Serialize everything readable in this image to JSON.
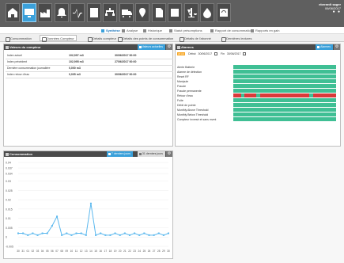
{
  "topbar": {
    "icons": [
      "home-icon",
      "monitor-icon",
      "factory-icon",
      "bell-icon",
      "pulse-icon",
      "building-icon",
      "network-icon",
      "truck-icon",
      "map-pin-icon",
      "document-icon",
      "list-icon",
      "scale-icon",
      "drop-icon",
      "gauge-icon"
    ],
    "active_index": 1,
    "user_line1": "eberardt sager",
    "user_line2": "06/06/2017",
    "user_dots": "● ●"
  },
  "nav1": {
    "items": [
      {
        "label": "Synthèse",
        "active": true
      },
      {
        "label": "Analyse",
        "active": false
      },
      {
        "label": "Historique",
        "active": false
      },
      {
        "label": "Statut présomptions",
        "active": false
      },
      {
        "label": "Rapport de consommation",
        "active": false
      },
      {
        "label": "Rapports en gain",
        "active": false
      }
    ]
  },
  "nav2": {
    "items": [
      {
        "label": "Consommation",
        "active": false
      },
      {
        "label": "Données Compteur",
        "active": true
      },
      {
        "label": "Détails compteur",
        "active": false
      },
      {
        "label": "Détails des points de consommation",
        "active": false
      },
      {
        "label": "Détails de l'abonné",
        "active": false
      },
      {
        "label": "Dernières lectures",
        "active": false
      }
    ]
  },
  "compteur": {
    "title": "Valeurs du compteur",
    "tab_label": "Valeurs actuelles",
    "rows": [
      {
        "label": "Index actuel",
        "value": "102,997 m3",
        "date": "30/06/2017 00:00"
      },
      {
        "label": "Index précédent",
        "value": "102,995 m3",
        "date": "27/06/2017 00:00"
      },
      {
        "label": "Dernière consommation journalière",
        "value": "0,000 m3",
        "date": ""
      },
      {
        "label": "Index retour d'eau",
        "value": "0,005 m3",
        "date": "30/06/2017 00:00"
      }
    ]
  },
  "alarmes": {
    "title": "Alarmes",
    "tab_label": "Alarmes",
    "filter_badge": "23 AU",
    "debut_label": "Début",
    "debut_value": "30/06/2017",
    "fin_label": "Fin",
    "fin_value": "30/06/2017",
    "labels": [
      "Alerte Batterie",
      "Alarme de détection",
      "Reset RF",
      "Manipule",
      "Fraude",
      "Fraude permanente",
      "Retour d'eau",
      "Fuite",
      "Débit de pointe",
      "Monthly Above Threshold",
      "Monthly Below Threshold",
      "Compteur inversé et sans mvmt"
    ],
    "columns": 27,
    "red_cells": [
      [
        6,
        0
      ],
      [
        6,
        1
      ],
      [
        6,
        3
      ],
      [
        6,
        4
      ],
      [
        6,
        5
      ],
      [
        6,
        7
      ],
      [
        6,
        8
      ],
      [
        6,
        9
      ],
      [
        6,
        10
      ],
      [
        6,
        11
      ],
      [
        6,
        12
      ],
      [
        6,
        13
      ],
      [
        6,
        14
      ],
      [
        6,
        15
      ],
      [
        6,
        16
      ],
      [
        6,
        17
      ],
      [
        6,
        18
      ],
      [
        6,
        19
      ],
      [
        6,
        21
      ],
      [
        6,
        22
      ],
      [
        6,
        23
      ],
      [
        6,
        24
      ],
      [
        6,
        25
      ],
      [
        6,
        26
      ]
    ]
  },
  "consommation": {
    "title": "Consommation",
    "tab1_label": "7 derniers jours",
    "tab2_label": "31 derniers jours"
  },
  "chart_data": {
    "type": "line",
    "categories": [
      "30",
      "31",
      "01",
      "02",
      "03",
      "04",
      "05",
      "06",
      "07",
      "08",
      "09",
      "10",
      "11",
      "12",
      "13",
      "14",
      "15",
      "16",
      "17",
      "18",
      "19",
      "20",
      "21",
      "22",
      "23",
      "24",
      "25",
      "26",
      "27",
      "28",
      "29",
      "30"
    ],
    "series": [
      {
        "values": [
          0.002,
          0.002,
          0.001,
          0.002,
          0.001,
          0.002,
          0.002,
          0.006,
          0.011,
          0.001,
          0.002,
          0.001,
          0.002,
          0.002,
          0.001,
          0.018,
          0.001,
          0.002,
          0.001,
          0.001,
          0.002,
          0.001,
          0.002,
          0.001,
          0.002,
          0.001,
          0.002,
          0.001,
          0.001,
          0.002,
          0.001,
          0.002
        ]
      }
    ],
    "yticks": [
      "0.04",
      "0.037",
      "0.034",
      "0.03",
      "0.025",
      "0.02",
      "0.015",
      "0.01",
      "0.005",
      "0",
      "-0.005"
    ],
    "ylim": [
      -0.005,
      0.04
    ],
    "color": "#5bb8ee"
  }
}
